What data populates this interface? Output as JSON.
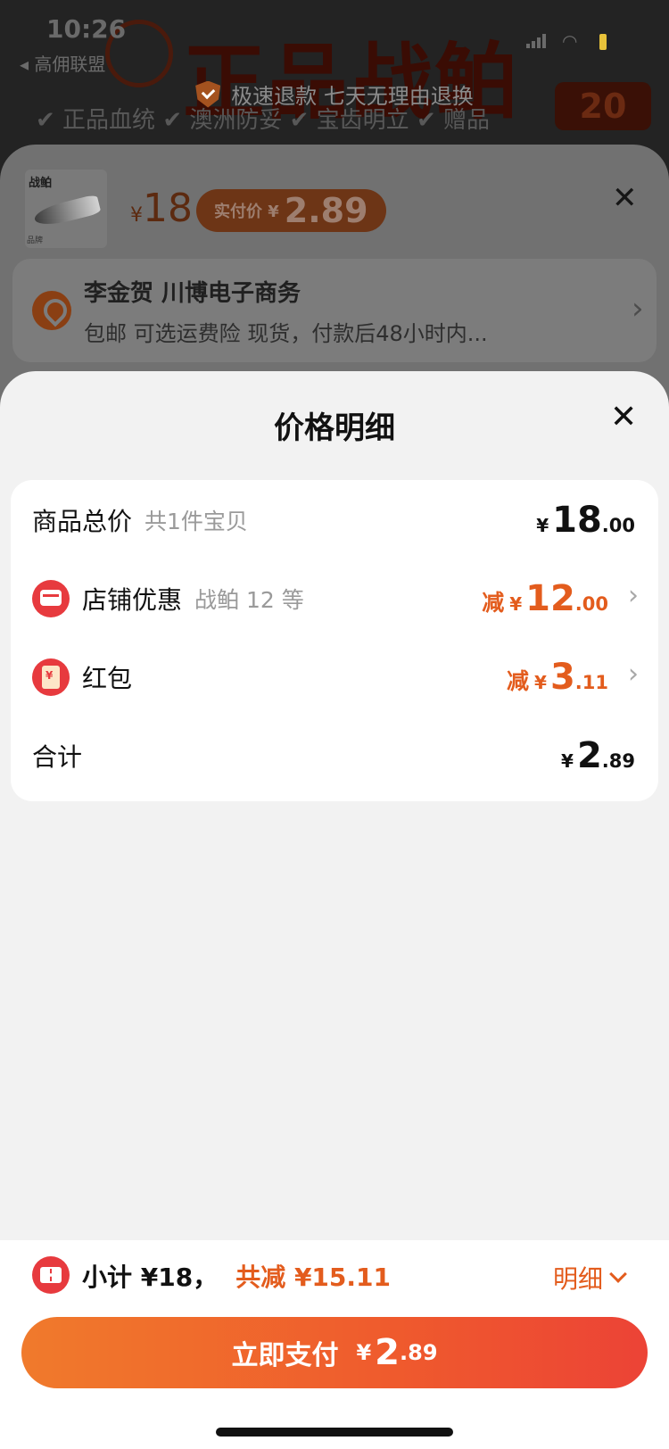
{
  "status_bar": {
    "time": "10:26",
    "back_label": "◂ 高佣联盟"
  },
  "background": {
    "banner_text": "正品战鲌",
    "refund_text": "极速退款 七天无理由退换",
    "features_text": "✔ 正品血统  ✔ 澳洲防妥  ✔ 宝齿明立  ✔ 赠品",
    "right_badge": "20"
  },
  "order": {
    "thumb_logo": "战鲌",
    "thumb_tag": "品牌",
    "price_yen": "¥",
    "price": "18",
    "actual_label": "实付价 ¥",
    "actual_amount": "2.89",
    "address_name": "李金贺 川博电子商务",
    "address_desc": "包邮  可选运费险  现货，付款后48小时内..."
  },
  "price_detail": {
    "title": "价格明细",
    "rows": [
      {
        "label": "商品总价",
        "sub": "共1件宝贝",
        "prefix": "",
        "yen": "¥",
        "int": "18",
        "dec": ".00"
      },
      {
        "label": "店铺优惠",
        "sub": "战鲌 12 等",
        "prefix": "减",
        "yen": "¥",
        "int": "12",
        "dec": ".00"
      },
      {
        "label": "红包",
        "sub": "",
        "prefix": "减",
        "yen": "¥",
        "int": "3",
        "dec": ".11"
      },
      {
        "label": "合计",
        "sub": "",
        "prefix": "",
        "yen": "¥",
        "int": "2",
        "dec": ".89"
      }
    ]
  },
  "footer": {
    "subtotal_text": "小计 ¥18，",
    "saved_text": "共减 ¥15.11",
    "detail_label": "明细",
    "pay_label": "立即支付",
    "pay_yen": "¥",
    "pay_int": "2",
    "pay_dec": ".89"
  },
  "colors": {
    "accent": "#e35c1d",
    "red": "#e73a3e",
    "card": "#ffffff",
    "sheet": "#f2f2f2"
  }
}
